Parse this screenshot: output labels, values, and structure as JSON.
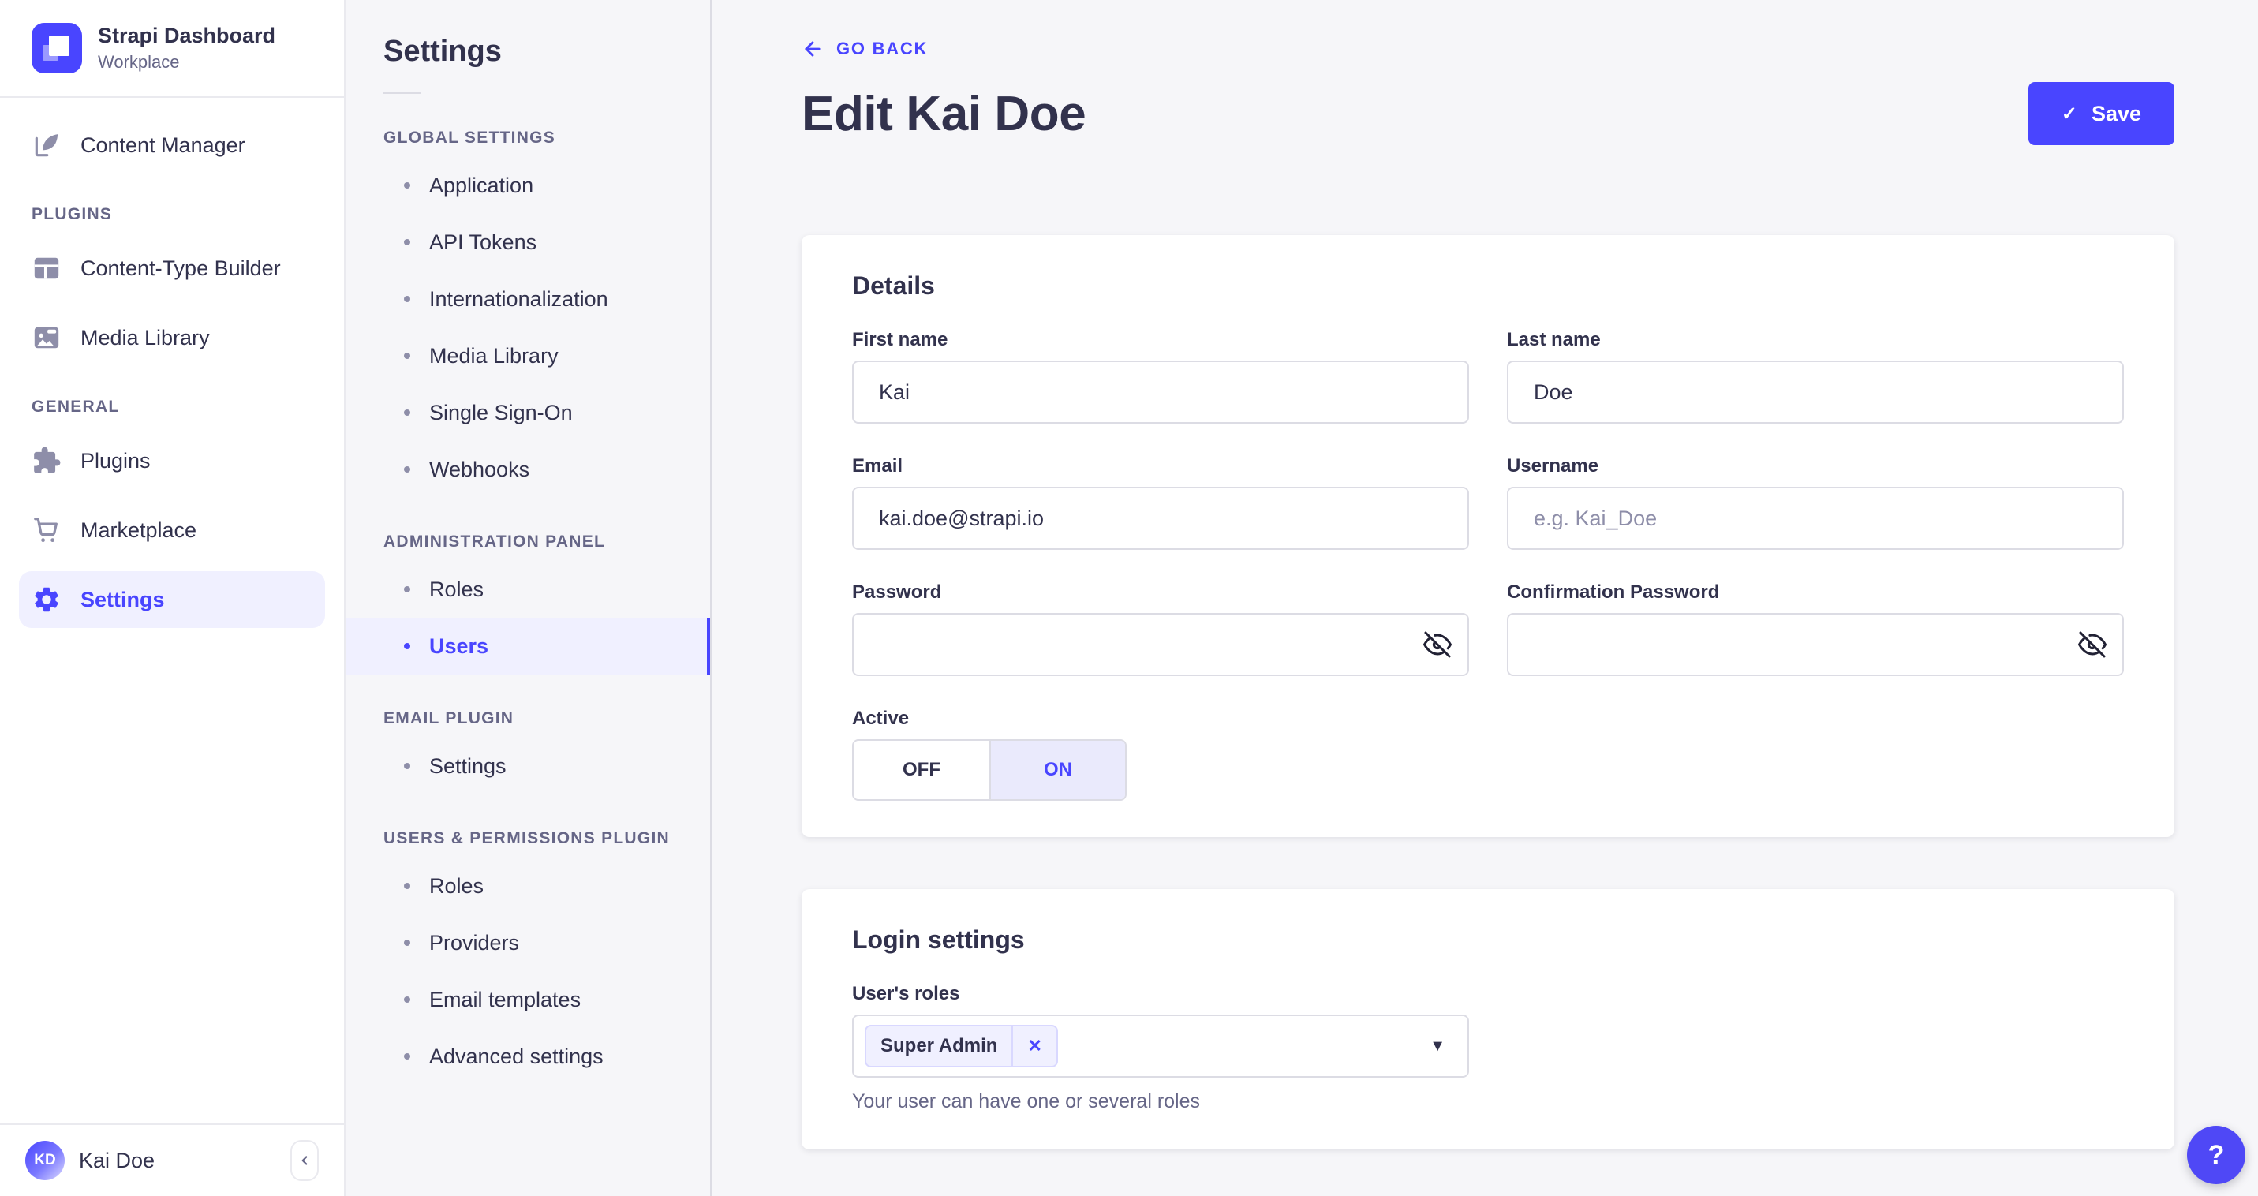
{
  "colors": {
    "accent": "#4945ff",
    "background": "#f6f6f9",
    "surface": "#ffffff",
    "text": "#32324d",
    "muted_text": "#666687",
    "border": "#dcdce4",
    "selected_background": "#f0f0ff"
  },
  "icons": {
    "close": "✕",
    "caret_down": "▼",
    "check": "✓",
    "question": "?"
  },
  "sidebar": {
    "logo_text": "Strapi Dashboard",
    "workspace": "Workplace",
    "primary_item": {
      "label": "Content Manager"
    },
    "sections": [
      {
        "header": "PLUGINS",
        "items": [
          {
            "label": "Content-Type Builder"
          },
          {
            "label": "Media Library"
          }
        ]
      },
      {
        "header": "GENERAL",
        "items": [
          {
            "label": "Plugins"
          },
          {
            "label": "Marketplace"
          },
          {
            "label": "Settings"
          }
        ]
      }
    ],
    "user": {
      "initials": "KD",
      "name": "Kai Doe"
    }
  },
  "subnav": {
    "title": "Settings",
    "groups": [
      {
        "header": "GLOBAL SETTINGS",
        "items": [
          {
            "label": "Application"
          },
          {
            "label": "API Tokens"
          },
          {
            "label": "Internationalization"
          },
          {
            "label": "Media Library"
          },
          {
            "label": "Single Sign-On"
          },
          {
            "label": "Webhooks"
          }
        ]
      },
      {
        "header": "ADMINISTRATION PANEL",
        "items": [
          {
            "label": "Roles"
          },
          {
            "label": "Users"
          }
        ]
      },
      {
        "header": "EMAIL PLUGIN",
        "items": [
          {
            "label": "Settings"
          }
        ]
      },
      {
        "header": "USERS & PERMISSIONS PLUGIN",
        "items": [
          {
            "label": "Roles"
          },
          {
            "label": "Providers"
          },
          {
            "label": "Email templates"
          },
          {
            "label": "Advanced settings"
          }
        ]
      }
    ],
    "active_item": "Users"
  },
  "header": {
    "back_label": "GO BACK",
    "title": "Edit Kai Doe",
    "save_label": "Save"
  },
  "details_card": {
    "title": "Details",
    "fields": [
      {
        "label": "First name",
        "value": "Kai"
      },
      {
        "label": "Last name",
        "value": "Doe"
      },
      {
        "label": "Email",
        "value": "kai.doe@strapi.io"
      },
      {
        "label": "Username",
        "value": "",
        "placeholder": "e.g. Kai_Doe"
      },
      {
        "label": "Password",
        "value": ""
      },
      {
        "label": "Confirmation Password",
        "value": ""
      }
    ],
    "active_toggle": {
      "label": "Active",
      "off_label": "OFF",
      "on_label": "ON",
      "value": "ON"
    }
  },
  "login_card": {
    "title": "Login settings",
    "roles_label": "User's roles",
    "selected_roles": [
      {
        "name": "Super Admin"
      }
    ],
    "helper_text": "Your user can have one or several roles"
  }
}
